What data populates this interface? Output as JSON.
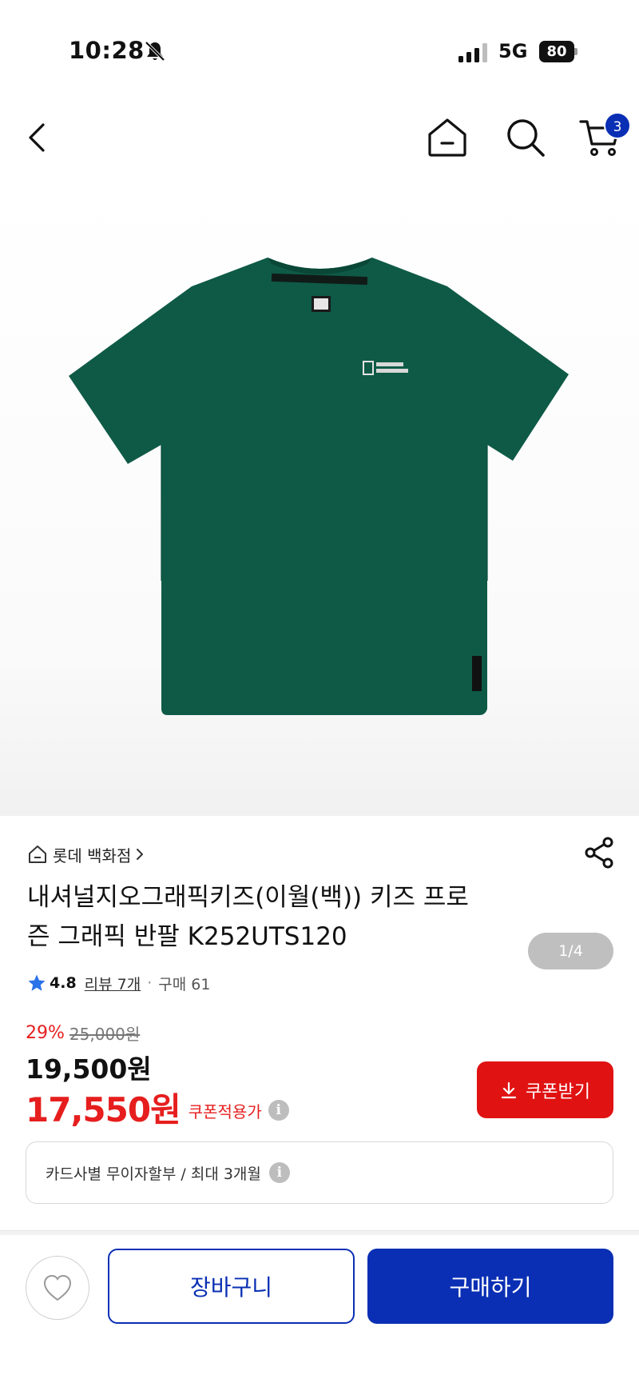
{
  "status_bar": {
    "time": "10:28",
    "network": "5G",
    "battery": "80"
  },
  "nav": {
    "cart_count": "3"
  },
  "gallery": {
    "counter": "1/4",
    "image_description": "green t-shirt",
    "shirt_color": "#0e5a46",
    "logo_text_line1": "NATIONAL",
    "logo_text_line2": "GEOGRAPHIC"
  },
  "product": {
    "store": "롯데 백화점",
    "title_line1": "내셔널지오그래픽키즈(이월(백)) 키즈 프로",
    "title_line2": "즌 그래픽 반팔 K252UTS120",
    "rating": "4.8",
    "reviews": "리뷰 7개",
    "separator": "·",
    "purchases": "구매 61"
  },
  "price": {
    "discount_rate": "29%",
    "original": "25,000원",
    "sale": "19,500원",
    "coupon_price": "17,550원",
    "coupon_label": "쿠폰적용가",
    "coupon_button": "쿠폰받기",
    "installment": "카드사별 무이자할부 / 최대 3개월",
    "info_glyph": "i"
  },
  "bottom_bar": {
    "cart_label": "장바구니",
    "buy_label": "구매하기"
  },
  "colors": {
    "accent_blue": "#0a2fb4",
    "accent_red": "#e01212"
  }
}
